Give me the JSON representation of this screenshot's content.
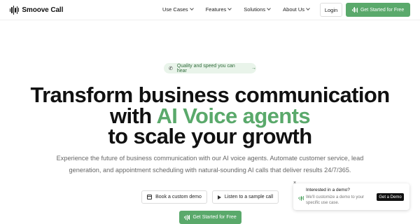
{
  "brand": {
    "name": "Smoove Call",
    "accent": "#5aa96b"
  },
  "nav": {
    "menu": [
      {
        "label": "Use Cases"
      },
      {
        "label": "Features"
      },
      {
        "label": "Solutions"
      },
      {
        "label": "About Us"
      }
    ],
    "login_label": "Login",
    "cta_label": "Get Started for Free"
  },
  "hero": {
    "pill_label": "Quality and speed you can hear",
    "headline_line1": "Transform business communication",
    "headline_line2_prefix": "with",
    "headline_line2_highlight": "AI Voice agents",
    "headline_line3": "to scale your growth",
    "subtext_line1": "Experience the future of business communication with our AI voice agents. Automate customer service, lead",
    "subtext_line2": "generation, and appointment scheduling with natural-sounding AI calls that deliver results 24/7/365.",
    "demo_button_label": "Book a custom demo",
    "listen_button_label": "Listen to a sample call",
    "cta_label": "Get Started for Free"
  },
  "popup": {
    "close_glyph": "×",
    "title": "Interested in a demo?",
    "body": "We'll customize a demo to your specific use case.",
    "button_label": "Get a Demo"
  },
  "icons": {
    "phone": "phone-icon",
    "arrow": "arrow-right-icon",
    "calendar": "calendar-icon",
    "play": "play-icon",
    "wave": "sound-wave-icon"
  }
}
